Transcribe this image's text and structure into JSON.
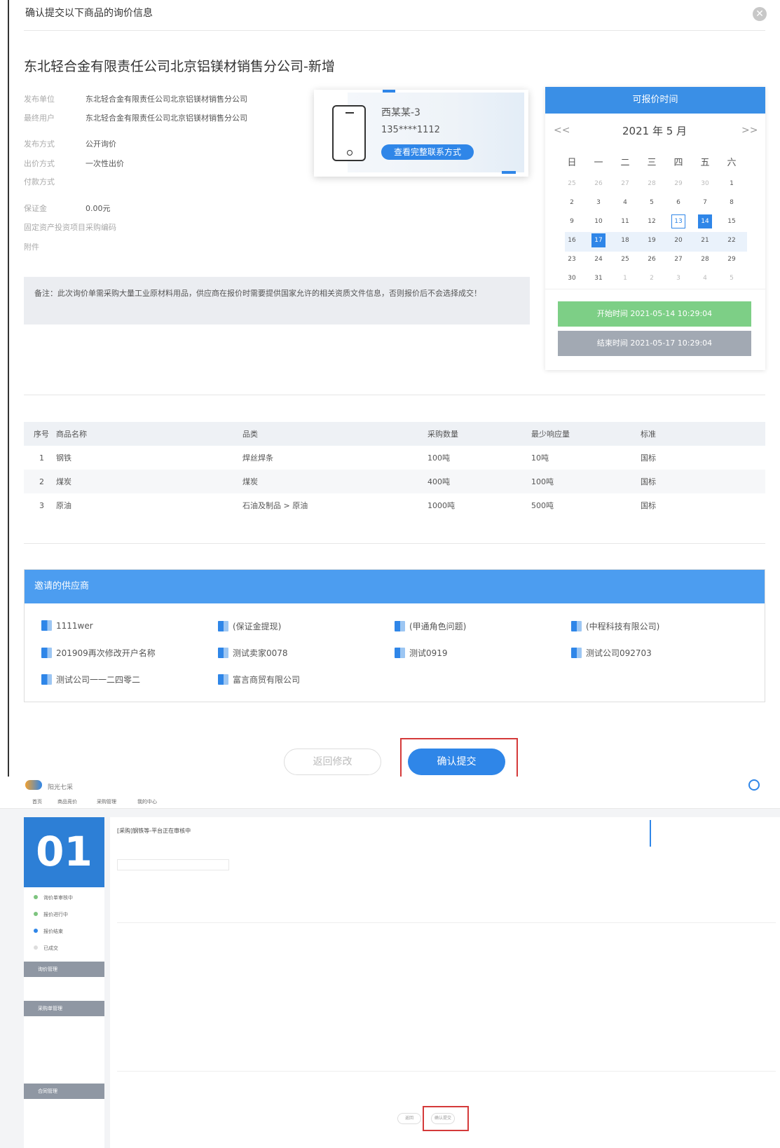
{
  "dialog": {
    "title": "确认提交以下商品的询价信息",
    "company": "东北轻合金有限责任公司北京铝镁材销售分公司-新增",
    "info": [
      {
        "label": "发布单位",
        "value": "东北轻合金有限责任公司北京铝镁材销售分公司"
      },
      {
        "label": "最终用户",
        "value": "东北轻合金有限责任公司北京铝镁材销售分公司"
      },
      {
        "label": "发布方式",
        "value": "公开询价"
      },
      {
        "label": "出价方式",
        "value": "一次性出价"
      },
      {
        "label": "付款方式",
        "value": ""
      },
      {
        "label": "保证金",
        "value": "0.00元"
      },
      {
        "label": "固定资产投资项目采购编码",
        "value": ""
      },
      {
        "label": "附件",
        "value": ""
      }
    ],
    "contact": {
      "name": "西某某-3",
      "phone": "135****1112",
      "button": "查看完整联系方式"
    },
    "calendar": {
      "header": "可报价时间",
      "prev": "<<",
      "next": ">>",
      "month_label": "2021 年  5 月",
      "weekdays": [
        "日",
        "一",
        "二",
        "三",
        "四",
        "五",
        "六"
      ],
      "weeks": [
        [
          "25",
          "26",
          "27",
          "28",
          "29",
          "30",
          "1"
        ],
        [
          "2",
          "3",
          "4",
          "5",
          "6",
          "7",
          "8"
        ],
        [
          "9",
          "10",
          "11",
          "12",
          "13",
          "14",
          "15"
        ],
        [
          "16",
          "17",
          "18",
          "19",
          "20",
          "21",
          "22"
        ],
        [
          "23",
          "24",
          "25",
          "26",
          "27",
          "28",
          "29"
        ],
        [
          "30",
          "31",
          "1",
          "2",
          "3",
          "4",
          "5"
        ]
      ],
      "start": "开始时间   2021-05-14 10:29:04",
      "end": "结束时间   2021-05-17 10:29:04"
    },
    "remark": "备注：此次询价单需采购大量工业原材料用品，供应商在报价时需要提供国家允许的相关资质文件信息，否则报价后不会选择成交！",
    "table": {
      "headers": [
        "序号",
        "商品名称",
        "品类",
        "采购数量",
        "最少响应量",
        "标准"
      ],
      "rows": [
        [
          "1",
          "钢铁",
          "焊丝焊条",
          "100吨",
          "10吨",
          "国标"
        ],
        [
          "2",
          "煤炭",
          "煤炭",
          "400吨",
          "100吨",
          "国标"
        ],
        [
          "3",
          "原油",
          "石油及制品 > 原油",
          "1000吨",
          "500吨",
          "国标"
        ]
      ]
    },
    "suppliers": {
      "title": "邀请的供应商",
      "items": [
        "1111wer",
        "(保证金提现)",
        "(甲通角色问题)",
        "(中程科技有限公司)",
        "201909再次修改开户名称",
        "测试卖家0078",
        "测试0919",
        "测试公司092703",
        "测试公司一一二四零二",
        "富言商贸有限公司"
      ]
    },
    "buttons": {
      "back": "返回修改",
      "confirm": "确认提交"
    }
  },
  "bg_page": {
    "logo": "阳光七采",
    "nav": [
      "首页",
      "商品竞价",
      "采购管理",
      "我的中心"
    ],
    "big_number": "01",
    "steps": [
      "询价单审核中",
      "报价进行中",
      "报价结束",
      "已成交"
    ],
    "groups": [
      "询价管理",
      "采购单管理",
      "合同管理"
    ],
    "title": "[采购]钢铁等-平台正在审核中",
    "buttons": [
      "返回",
      "确认提交"
    ]
  },
  "colors": {
    "primary": "#2f86e8",
    "start": "#7dcf86",
    "end": "#a2a9b3",
    "highlight": "#d43a3a"
  }
}
